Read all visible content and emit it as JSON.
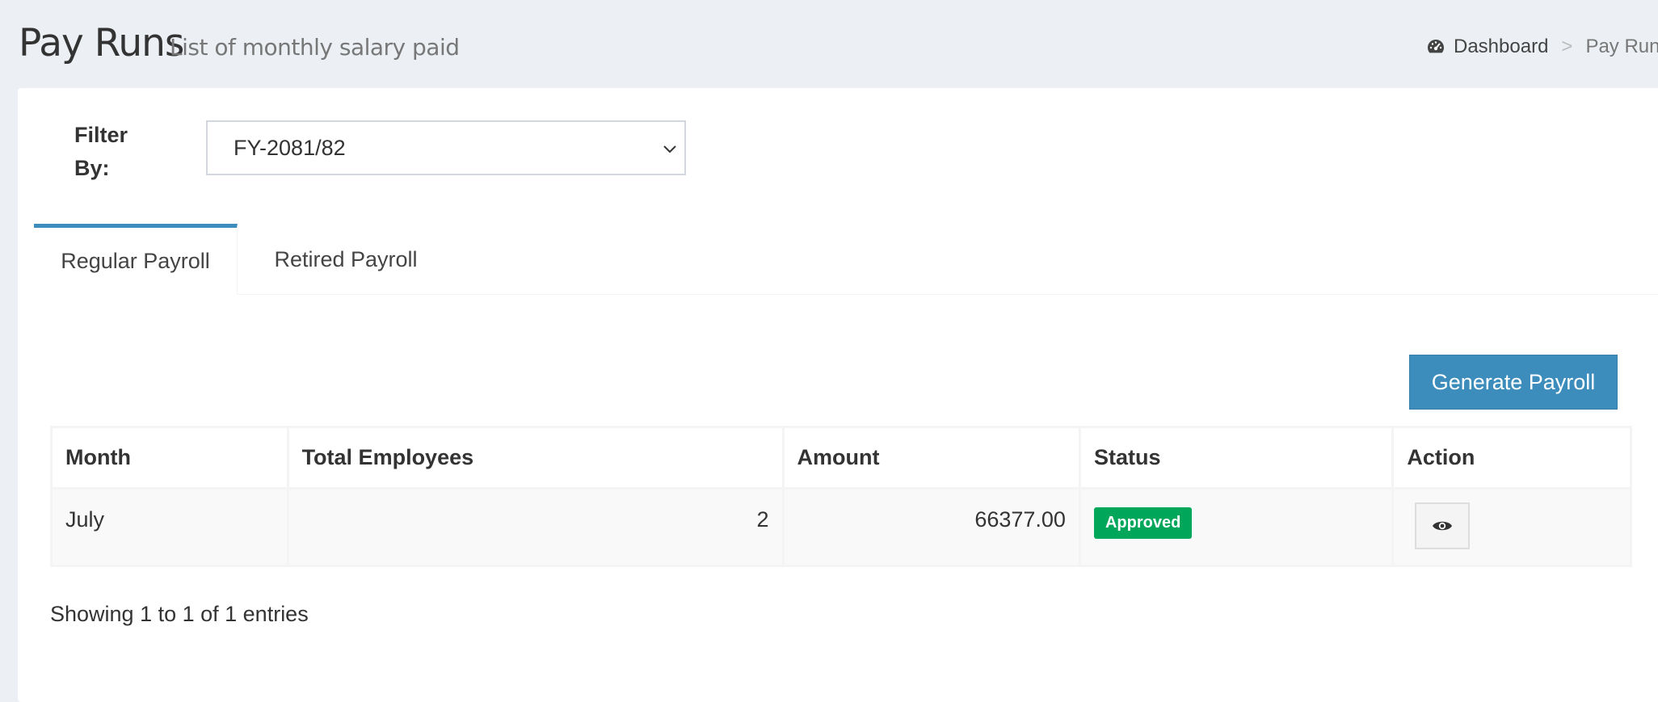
{
  "header": {
    "title": "Pay Runs",
    "subtitle": "List of monthly salary paid"
  },
  "breadcrumb": {
    "home_label": "Dashboard",
    "home_icon": "dashboard-icon",
    "separator": ">",
    "current": "Pay Runs"
  },
  "filter": {
    "label": "Filter By:",
    "selected": "FY-2081/82"
  },
  "tabs": [
    {
      "label": "Regular Payroll",
      "active": true
    },
    {
      "label": "Retired Payroll",
      "active": false
    }
  ],
  "actions": {
    "generate_label": "Generate Payroll"
  },
  "table": {
    "columns": [
      "Month",
      "Total Employees",
      "Amount",
      "Status",
      "Action"
    ],
    "rows": [
      {
        "month": "July",
        "total_employees": "2",
        "amount": "66377.00",
        "status": "Approved",
        "action_icon": "eye-icon"
      }
    ]
  },
  "pagination": {
    "info": "Showing 1 to 1 of 1 entries"
  },
  "colors": {
    "primary": "#3c8dbc",
    "success": "#00a65a",
    "background": "#ecf0f5"
  }
}
